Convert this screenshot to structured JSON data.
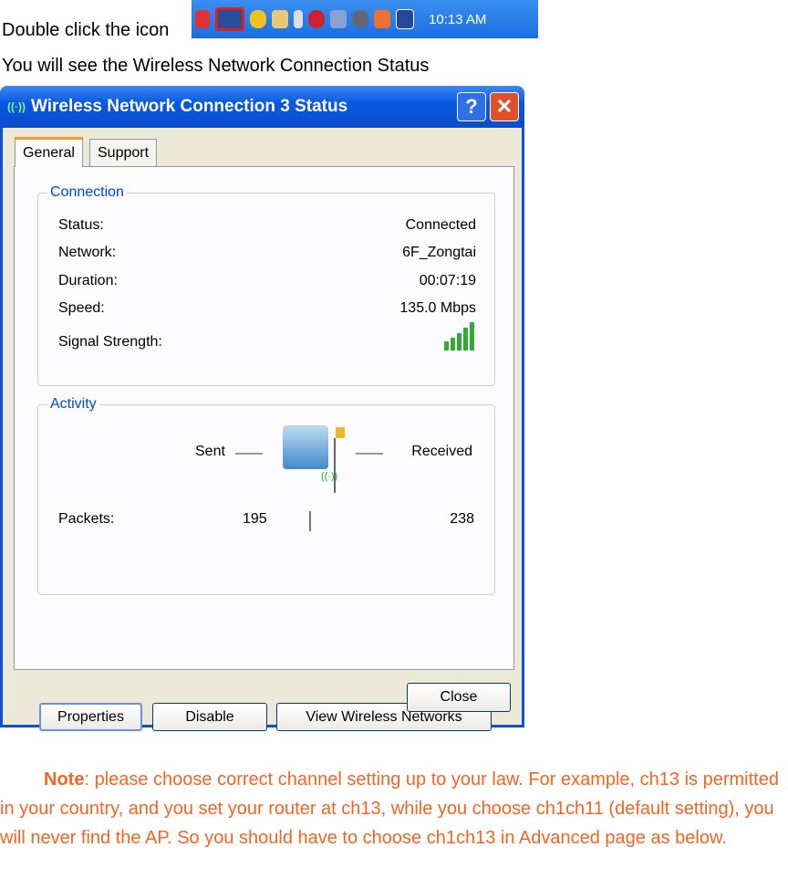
{
  "doc": {
    "line1": "Double click the icon",
    "line2": "You will see the Wireless Network Connection Status",
    "note_label": "Note",
    "note_text": ": please choose correct channel setting up to your law. For example, ch13 is permitted in your country, and you set your router at ch13, while you choose ch1ch11 (default setting), you will never find the AP. So you should have to choose ch1ch13 in Advanced page as below."
  },
  "tray": {
    "clock": "10:13 AM",
    "icons": [
      "network-arrow-icon",
      "wireless-network-icon",
      "security-shield-icon",
      "key-icon",
      "battery-icon",
      "antivirus-icon",
      "network-disconnected-icon",
      "media-icon",
      "volume-icon",
      "display-icon"
    ],
    "highlight_color": "#e02020"
  },
  "dialog": {
    "title": "Wireless Network Connection 3 Status",
    "help": "?",
    "close": "✕",
    "tabs": [
      "General",
      "Support"
    ],
    "connection": {
      "legend": "Connection",
      "rows": [
        {
          "label": "Status:",
          "value": "Connected"
        },
        {
          "label": "Network:",
          "value": "6F_Zongtai"
        },
        {
          "label": "Duration:",
          "value": "00:07:19"
        },
        {
          "label": "Speed:",
          "value": "135.0 Mbps"
        }
      ],
      "signal_label": "Signal Strength:",
      "signal_bars": 5
    },
    "activity": {
      "legend": "Activity",
      "sent": "Sent",
      "received": "Received",
      "packets_label": "Packets:",
      "packets_sent": "195",
      "packets_received": "238"
    },
    "buttons": {
      "properties": "Properties",
      "disable": "Disable",
      "view": "View Wireless Networks",
      "close": "Close"
    }
  },
  "colors": {
    "note": "#f26522",
    "title_bar": "#0a58e0"
  }
}
